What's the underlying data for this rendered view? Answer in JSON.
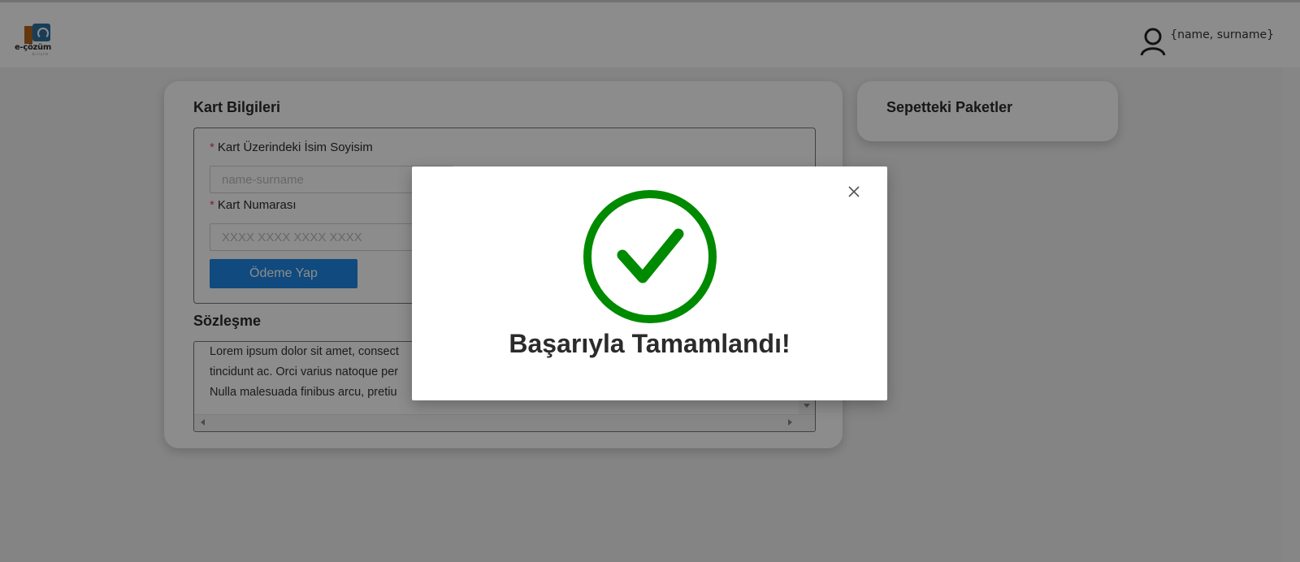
{
  "header": {
    "logo_text": "e-çözüm",
    "logo_sub": "bilişim",
    "user_name": "{name, surname}"
  },
  "card_form": {
    "title": "Kart Bilgileri",
    "name_label": "Kart Üzerindeki İsim Soyisim",
    "name_placeholder": "name-surname",
    "number_label": "Kart Numarası",
    "number_placeholder": "XXXX XXXX XXXX XXXX",
    "required_mark": "*",
    "pay_label": "Ödeme Yap"
  },
  "contract": {
    "title": "Sözleşme",
    "lines": [
      "Lorem ipsum dolor sit amet, consect",
      "tincidunt ac. Orci varius natoque per",
      "Nulla malesuada finibus arcu, pretiu"
    ]
  },
  "basket": {
    "title": "Sepetteki Paketler"
  },
  "modal": {
    "message": "Başarıyla Tamamlandı!",
    "success_color": "#008a00",
    "close_icon": "close-icon",
    "status_icon": "check-circle-icon"
  }
}
